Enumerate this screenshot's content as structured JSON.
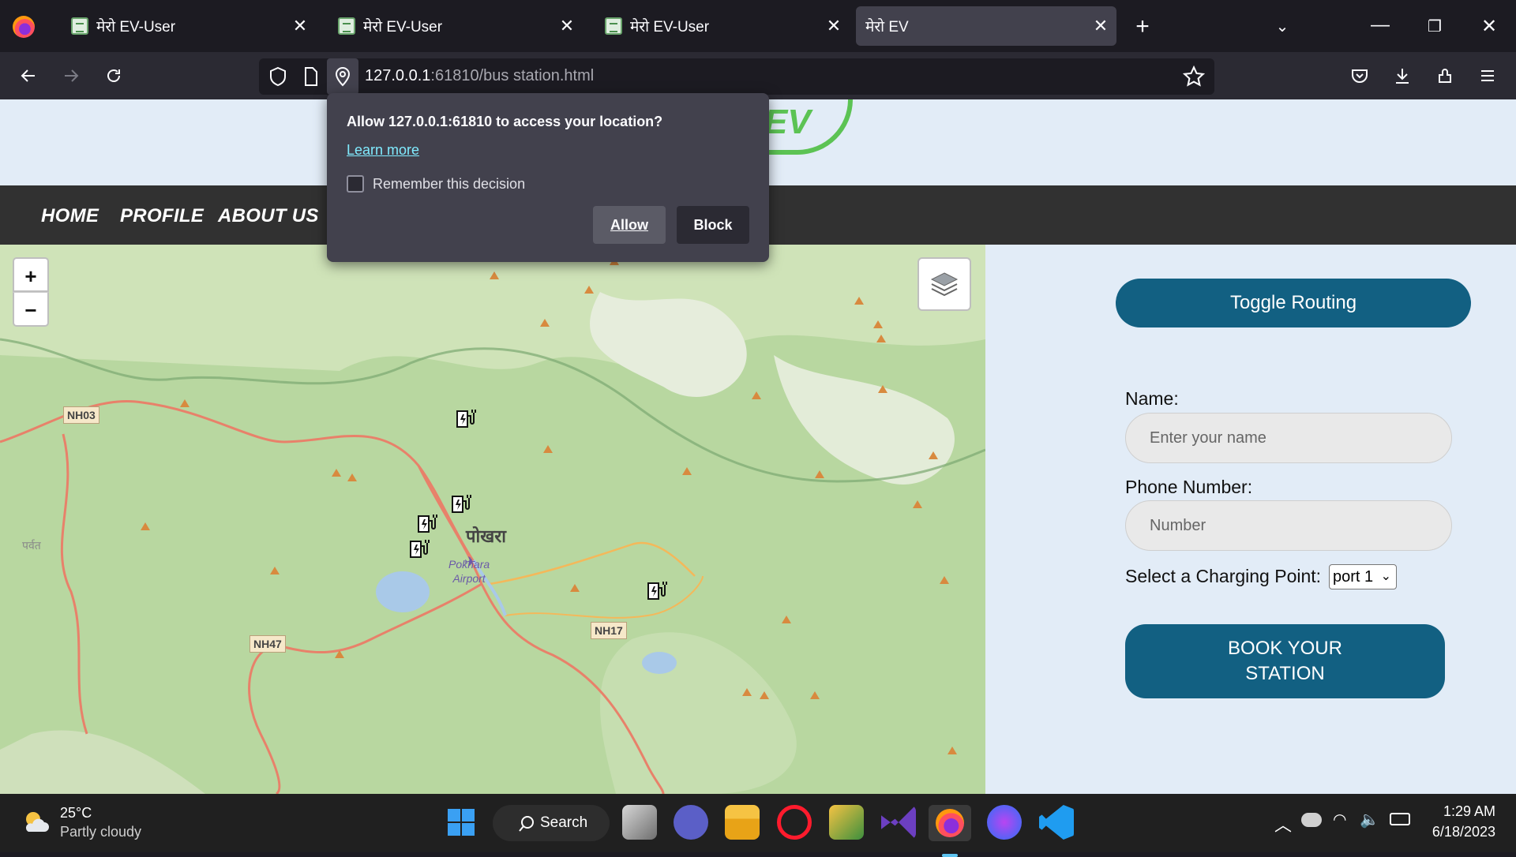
{
  "browser": {
    "tabs": [
      {
        "title": "मेरो EV-User",
        "active": false
      },
      {
        "title": "मेरो EV-User",
        "active": false
      },
      {
        "title": "मेरो EV-User",
        "active": false
      },
      {
        "title": "मेरो EV",
        "active": true
      }
    ],
    "new_tab": "+",
    "url_host": "127.0.0.1",
    "url_rest": ":61810/bus station.html",
    "icons": [
      "back-icon",
      "forward-icon",
      "reload-icon",
      "shield-icon",
      "page-icon",
      "location-icon",
      "star-icon",
      "pocket-icon",
      "download-icon",
      "extensions-icon",
      "menu-icon"
    ]
  },
  "popup": {
    "message": "Allow 127.0.0.1:61810 to access your location?",
    "learn_more": "Learn more",
    "remember": "Remember this decision",
    "allow": "Allow",
    "block": "Block"
  },
  "site": {
    "logo_text": "EV",
    "nav": [
      "HOME",
      "PROFILE",
      "ABOUT US"
    ]
  },
  "map": {
    "zoom_in": "+",
    "zoom_out": "−",
    "labels": {
      "nh03": "NH03",
      "nh47": "NH47",
      "nh17": "NH17",
      "city": "पोखरा",
      "airport_1": "Pokhara",
      "airport_2": "Airport",
      "parbat": "पर्वत"
    }
  },
  "form": {
    "toggle_routing": "Toggle Routing",
    "name_label": "Name:",
    "name_placeholder": "Enter your name",
    "phone_label": "Phone Number:",
    "phone_placeholder": "Number",
    "port_label": "Select a Charging Point:",
    "port_selected": "port 1",
    "book_line1": "BOOK YOUR",
    "book_line2": "STATION"
  },
  "taskbar": {
    "temperature": "25°C",
    "weather": "Partly cloudy",
    "search": "Search",
    "time": "1:29 AM",
    "date": "6/18/2023"
  }
}
